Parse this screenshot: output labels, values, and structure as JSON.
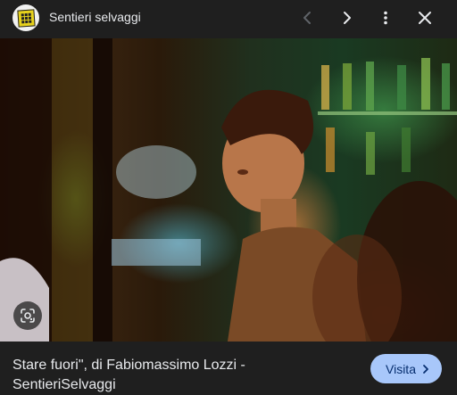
{
  "header": {
    "site_name": "Sentieri selvaggi",
    "logo_icon": "sentieri-selvaggi-logo",
    "prev_icon": "chevron-left-icon",
    "next_icon": "chevron-right-icon",
    "more_icon": "more-vert-icon",
    "close_icon": "close-icon"
  },
  "image": {
    "lens_icon": "google-lens-icon"
  },
  "footer": {
    "caption": "Stare fuori\", di Fabiomassimo Lozzi - SentieriSelvaggi",
    "visit_label": "Visita",
    "visit_icon": "chevron-right-icon"
  },
  "colors": {
    "background": "#1f1f1f",
    "visit_button": "#a8c7fa",
    "visit_text": "#062e6f",
    "logo_yellow": "#e7d21c"
  }
}
